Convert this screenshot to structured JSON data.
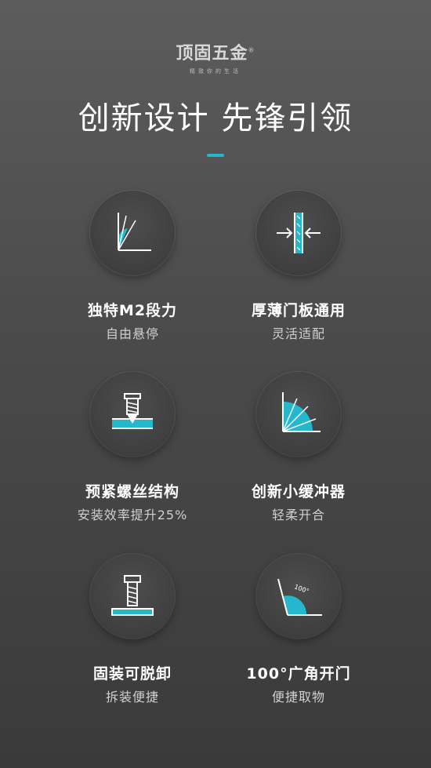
{
  "brand": {
    "name": "顶固五金",
    "registered": "®",
    "slogan": "精致你的生活"
  },
  "headline": "创新设计 先锋引领",
  "features": [
    {
      "title": "独特M2段力",
      "subtitle": "自由悬停",
      "icon": "angle-hover-icon"
    },
    {
      "title": "厚薄门板通用",
      "subtitle": "灵活适配",
      "icon": "door-thickness-icon"
    },
    {
      "title": "预紧螺丝结构",
      "subtitle": "安装效率提升25%",
      "icon": "screw-pretension-icon"
    },
    {
      "title": "创新小缓冲器",
      "subtitle": "轻柔开合",
      "icon": "buffer-angle-icon"
    },
    {
      "title": "固装可脱卸",
      "subtitle": "拆装便捷",
      "icon": "bolt-detach-icon"
    },
    {
      "title": "100°广角开门",
      "subtitle": "便捷取物",
      "icon": "wide-angle-100-icon",
      "angle_label": "100°"
    }
  ],
  "colors": {
    "accent": "#25b7cc",
    "line": "#ffffff"
  }
}
